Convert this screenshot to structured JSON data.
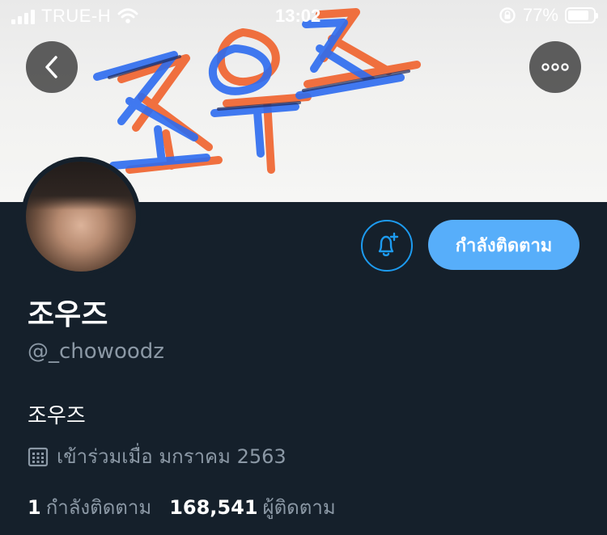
{
  "status_bar": {
    "carrier": "TRUE-H",
    "time": "13:02",
    "battery_percent": "77%",
    "signal_icon": "signal-bars-icon",
    "wifi_icon": "wifi-icon",
    "rotation_lock_icon": "rotation-lock-icon",
    "battery_icon": "battery-icon"
  },
  "banner": {
    "description": "handwritten banner art"
  },
  "header_buttons": {
    "back_icon": "chevron-left-icon",
    "more_icon": "more-dots-icon"
  },
  "profile": {
    "display_name": "조우즈",
    "handle": "@_chowoodz",
    "bio": "조우즈",
    "joined_text": "เข้าร่วมเมื่อ มกราคม 2563",
    "joined_icon": "calendar-icon",
    "follow_button_label": "กำลังติดตาม",
    "notify_icon": "bell-plus-icon",
    "stats": {
      "following_count": "1",
      "following_label": "กำลังติดตาม",
      "followers_count": "168,541",
      "followers_label": "ผู้ติดตาม"
    }
  },
  "colors": {
    "background": "#15202b",
    "accent": "#1d9bf0",
    "follow_button": "#57aefa",
    "muted_text": "#8b98a5",
    "banner_blue": "#2d6cf0",
    "banner_orange": "#f0622c"
  }
}
